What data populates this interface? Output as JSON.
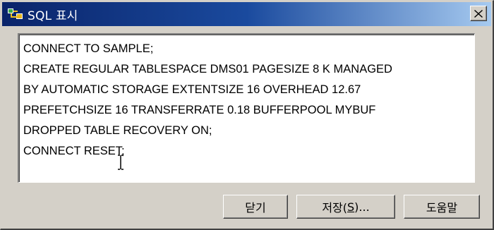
{
  "window": {
    "title": "SQL 표시",
    "icon": "db2-app-icon",
    "close_icon": "close-icon"
  },
  "sql": {
    "lines": [
      "CONNECT TO SAMPLE;",
      "CREATE  REGULAR  TABLESPACE DMS01 PAGESIZE 8 K  MANAGED",
      "BY AUTOMATIC STORAGE EXTENTSIZE 16 OVERHEAD 12.67",
      "PREFETCHSIZE 16 TRANSFERRATE 0.18 BUFFERPOOL  MYBUF",
      "DROPPED TABLE RECOVERY ON;",
      "CONNECT RESET;"
    ]
  },
  "buttons": {
    "close_label": "닫기",
    "save_prefix": "저장(",
    "save_mnemonic": "S",
    "save_suffix": ")...",
    "help_label": "도움말"
  },
  "colors": {
    "title_bar": "#0a246a",
    "title_bar_gradient_end": "#a6caf0",
    "dialog_face": "#d4d0c8",
    "text_area": "#ffffff"
  }
}
